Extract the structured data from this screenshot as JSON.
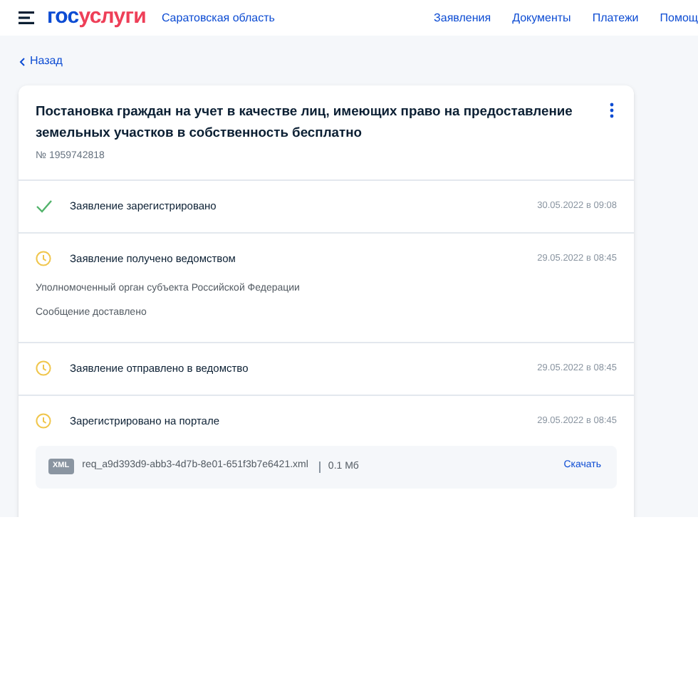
{
  "header": {
    "logo": {
      "part1": "гос",
      "part2": "услуги"
    },
    "region": "Саратовская область",
    "nav": [
      "Заявления",
      "Документы",
      "Платежи",
      "Помощ"
    ]
  },
  "back_link": "Назад",
  "application": {
    "title": "Постановка граждан на учет в качестве лиц, имеющих право на предоставление земельных участков в собственность бесплатно",
    "number": "№ 1959742818",
    "steps": [
      {
        "kind": "done",
        "label": "Заявление зарегистрировано",
        "date": "30.05.2022 в 09:08"
      },
      {
        "kind": "pending",
        "label": "Заявление получено ведомством",
        "date": "29.05.2022 в 08:45",
        "details": [
          "Уполномоченный орган субъекта Российской Федерации",
          "Сообщение доставлено"
        ]
      },
      {
        "kind": "pending",
        "label": "Заявление отправлено в ведомство",
        "date": "29.05.2022 в 08:45"
      },
      {
        "kind": "pending",
        "label": "Зарегистрировано на портале",
        "date": "29.05.2022 в 08:45",
        "file": {
          "type": "XML",
          "name": "req_a9d393d9-abb3-4d7b-8e01-651f3b7e6421.xml",
          "size": "0.1 Мб",
          "action": "Скачать"
        }
      }
    ]
  }
}
